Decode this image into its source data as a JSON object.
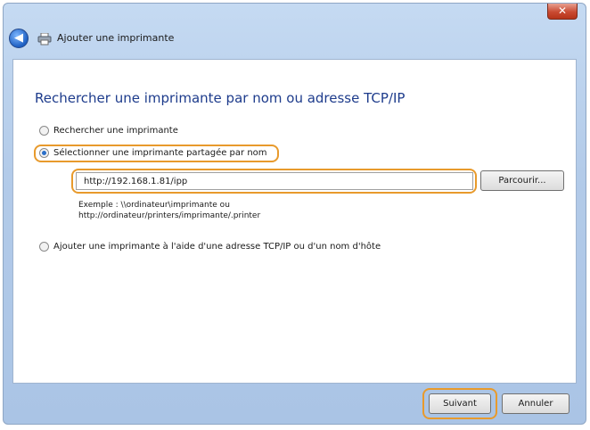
{
  "window": {
    "title": "Ajouter une imprimante",
    "close_label": "✕",
    "back_label": "◀"
  },
  "main": {
    "heading": "Rechercher une imprimante par nom ou adresse TCP/IP",
    "options": [
      {
        "label": "Rechercher une imprimante",
        "selected": false
      },
      {
        "label": "Sélectionner une imprimante partagée par nom",
        "selected": true
      },
      {
        "label": "Ajouter une imprimante à l'aide d'une adresse TCP/IP ou d'un nom d'hôte",
        "selected": false
      }
    ],
    "url_value": "http://192.168.1.81/ipp",
    "browse_label": "Parcourir...",
    "example_line1": "Exemple : \\\\ordinateur\\imprimante ou",
    "example_line2": "http://ordinateur/printers/imprimante/.printer"
  },
  "footer": {
    "next_label": "Suivant",
    "cancel_label": "Annuler"
  },
  "colors": {
    "heading": "#1e3c8c",
    "highlight": "#e89a2c",
    "frame": "#b3cbe9"
  }
}
